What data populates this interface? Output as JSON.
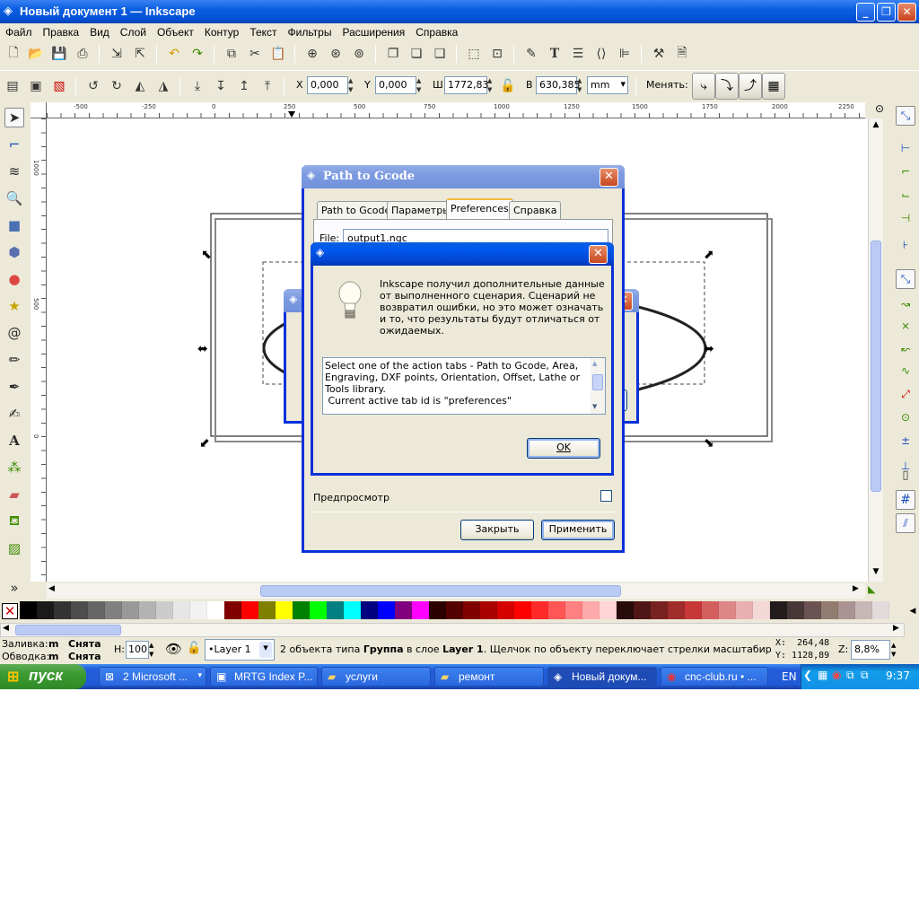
{
  "window": {
    "title": "Новый документ 1 — Inkscape",
    "min": "_",
    "max": "❐",
    "close": "✕"
  },
  "menu": [
    "Файл",
    "Правка",
    "Вид",
    "Слой",
    "Объект",
    "Контур",
    "Текст",
    "Фильтры",
    "Расширения",
    "Справка"
  ],
  "coords": {
    "x_label": "X",
    "x_value": "0,000",
    "y_label": "Y",
    "y_value": "0,000",
    "w_label": "Ш",
    "w_value": "1772,83",
    "h_label": "В",
    "h_value": "630,385",
    "unit": "mm",
    "change_label": "Менять:"
  },
  "ruler_h": [
    "-500",
    "-250",
    "0",
    "250",
    "500",
    "750",
    "1000",
    "1250",
    "1500",
    "1750",
    "2000",
    "2250"
  ],
  "ruler_v": [
    "1000",
    "500",
    "0"
  ],
  "gcode_dialog": {
    "title": "Path to Gcode",
    "tabs": [
      "Path to Gcode",
      "Параметры",
      "Preferences",
      "Справка"
    ],
    "file_label": "File:",
    "file_value": "output1.ngc",
    "preview_label": "Предпросмотр",
    "close_btn": "Закрыть",
    "apply_btn": "Применить"
  },
  "bg_dialog": {
    "ellipsis": "..."
  },
  "message_dialog": {
    "text": "Inkscape получил дополнительные данные от выполненного сценария. Сценарий не возвратил ошибки, но это может означать и то, что результаты будут отличаться от ожидаемых.",
    "log_line1": "Select one of the action tabs - Path to Gcode, Area, Engraving, DXF points, Orientation, Offset, Lathe or Tools library.",
    "log_line2": " Current active tab id is \"preferences\"",
    "ok": "OK"
  },
  "palette": [
    "#000000",
    "#1a1a1a",
    "#333333",
    "#4d4d4d",
    "#666666",
    "#808080",
    "#999999",
    "#b3b3b3",
    "#cccccc",
    "#e6e6e6",
    "#f2f2f2",
    "#ffffff",
    "#800000",
    "#ff0000",
    "#808000",
    "#ffff00",
    "#008000",
    "#00ff00",
    "#008080",
    "#00ffff",
    "#000080",
    "#0000ff",
    "#800080",
    "#ff00ff",
    "#2b0000",
    "#550000",
    "#800000",
    "#aa0000",
    "#d40000",
    "#ff0000",
    "#ff2a2a",
    "#ff5555",
    "#ff8080",
    "#ffaaaa",
    "#ffd5d5",
    "#280b0b",
    "#501616",
    "#782121",
    "#a02c2c",
    "#c83737",
    "#d35f5f",
    "#de8787",
    "#e9afaf",
    "#f4d7d7",
    "#241c1c",
    "#483737",
    "#6c5353",
    "#917c6f",
    "#ac9393",
    "#c8b7b7",
    "#e3dbdb"
  ],
  "status": {
    "fill_label": "Заливка:",
    "fill_m": "m",
    "fill_value": "Снята",
    "stroke_label": "Обводка:",
    "stroke_m": "m",
    "stroke_value": "Снята",
    "h_label": "Н:",
    "h_value": "100",
    "layer": "•Layer 1",
    "message_pre": "2 объекта типа ",
    "message_bold1": "Группа",
    "message_mid": " в слое ",
    "message_bold2": "Layer 1",
    "message_post": ". Щелчок по объекту переключает стрелки масштабирования/вра...",
    "x_coord": "X:  264,48",
    "y_coord": "Y: 1128,89",
    "zoom_label": "Z:",
    "zoom_value": "8,8%"
  },
  "taskbar": {
    "start": "пуск",
    "tasks": [
      "2 Microsoft ...",
      "MRTG Index P...",
      "услуги",
      "ремонт",
      "Новый докум...",
      "cnc-club.ru • ..."
    ],
    "lang": "EN",
    "time": "9:37"
  }
}
